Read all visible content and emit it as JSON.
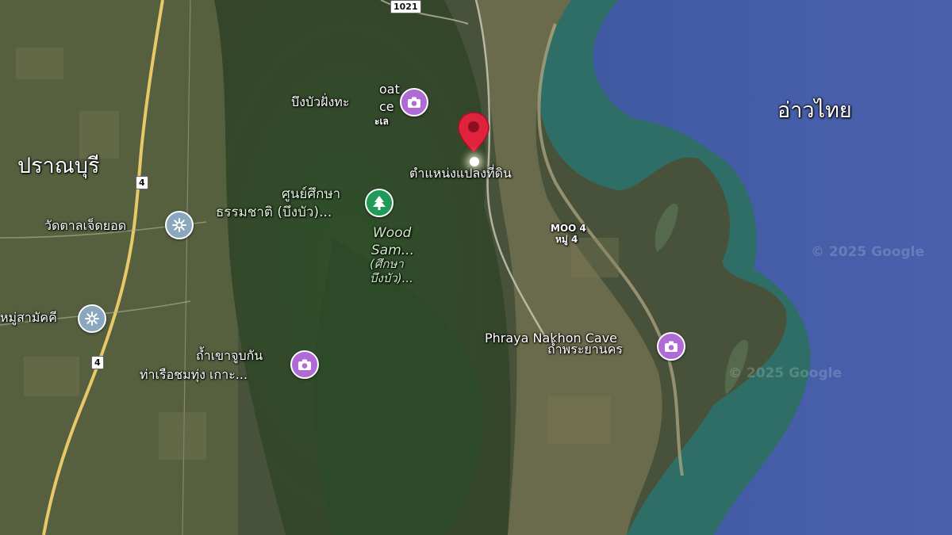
{
  "map": {
    "sea_label": "อ่าวไทย",
    "province_label": "ปราณบุรี",
    "road_shields": [
      "1021",
      "4",
      "4"
    ],
    "place_labels": {
      "boat_place_partial": "oat",
      "boat_place_partial2": "ce",
      "lotus_pond": "บึงบัวฝั่งทะ",
      "lotus_pond_sub": "ะเล",
      "land_location": "ตำแหน่งแปลงที่ดิน",
      "nature_center_line1": "ศูนย์ศึกษา",
      "nature_center_line2": "ธรรมชาติ (บึงบัว)...",
      "wood_line1": "Wood",
      "wood_line2": "Sam...",
      "wood_line3": "(ศึกษา",
      "wood_line4": "บึงบัว)...",
      "temple_1": "วัดตาลเจ็ดยอด",
      "temple_2": "หมู่สามัคคี",
      "cave_pier_line1": "ถ้ำเขาจูบกัน",
      "cave_pier_line2": "ท่าเรือชมทุ่ง เกาะ...",
      "moo_line1": "MOO 4",
      "moo_line2": "หมู่ 4",
      "cave_en": "Phraya Nakhon Cave",
      "cave_th": "ถ้ำพระยานคร"
    },
    "watermarks": [
      "© 2025 Google",
      "© 2025 Google"
    ],
    "colors": {
      "sea": "#4a5fa8",
      "shallow": "#2f6e66",
      "land": "#3a4a2c",
      "poi_purple": "#b06ad6",
      "park_green": "#1f9a58",
      "temple_blue": "#8aa7bd",
      "pin_red": "#e0233d",
      "highway_yellow": "#e9c86a"
    },
    "icons": {
      "camera": "camera-icon",
      "tree": "tree-icon",
      "temple": "temple-icon",
      "pin": "location-pin-icon"
    }
  }
}
